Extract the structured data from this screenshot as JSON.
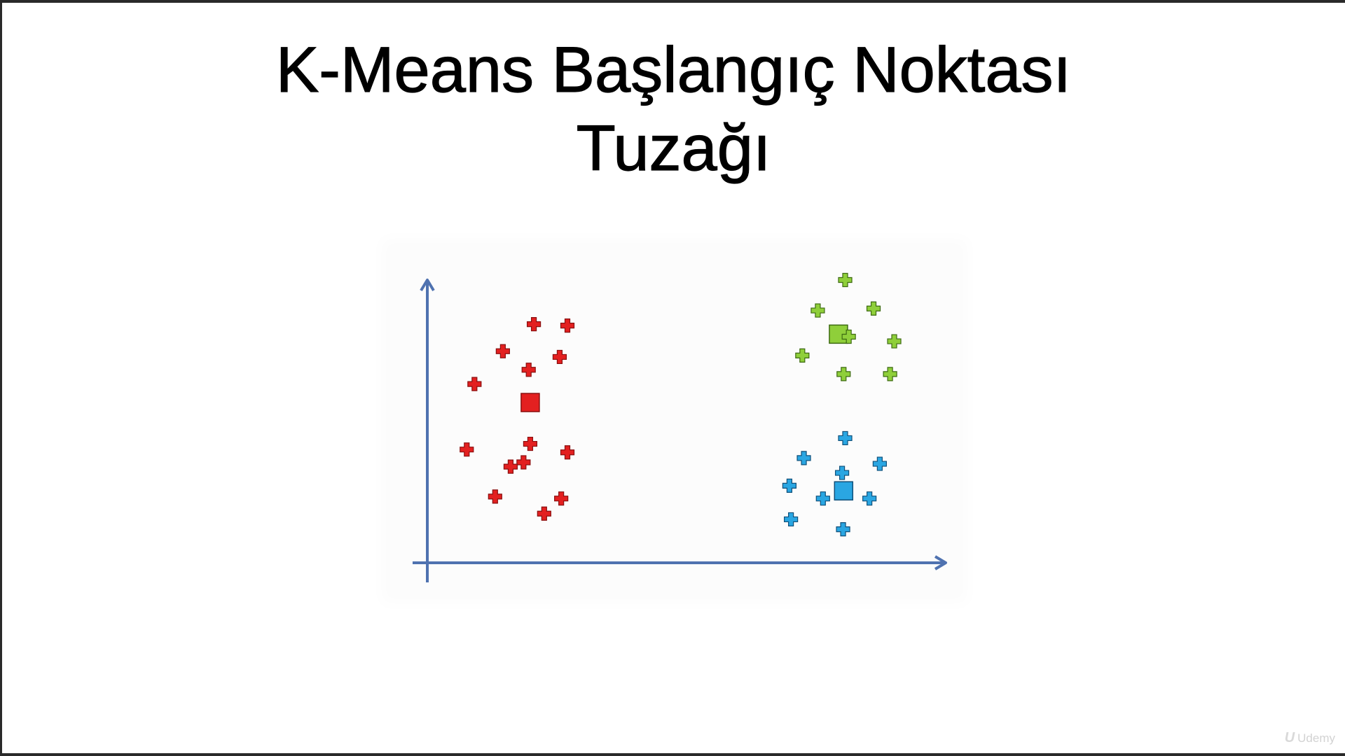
{
  "slide": {
    "title_line1": "K-Means Başlangıç Noktası",
    "title_line2": "Tuzağı"
  },
  "watermark": {
    "icon": "udemy-logo-icon",
    "text": "Udemy"
  },
  "chart_data": {
    "type": "scatter",
    "title": "",
    "xlabel": "",
    "ylabel": "",
    "axis_ticks": false,
    "grid": false,
    "xlim": [
      0,
      100
    ],
    "ylim": [
      0,
      100
    ],
    "series": [
      {
        "color": "#e32020",
        "stroke": "#8a1010",
        "points": [
          [
            20.5,
            84
          ],
          [
            27,
            83.5
          ],
          [
            14.5,
            74.5
          ],
          [
            25.5,
            72.5
          ],
          [
            19.5,
            68
          ],
          [
            9,
            63
          ],
          [
            18.5,
            35.5
          ],
          [
            27,
            39
          ],
          [
            7.5,
            40
          ],
          [
            16,
            34
          ],
          [
            25.8,
            22.8
          ],
          [
            13,
            23.5
          ],
          [
            22.5,
            17.5
          ],
          [
            19.8,
            42
          ]
        ],
        "centroid": [
          19.8,
          56.5
        ]
      },
      {
        "color": "#8fcf3a",
        "stroke": "#3d6a12",
        "points": [
          [
            80.8,
            99.5
          ],
          [
            75.5,
            88.8
          ],
          [
            86.3,
            89.5
          ],
          [
            81.5,
            79.6
          ],
          [
            90.3,
            78
          ],
          [
            72.5,
            73
          ],
          [
            80.5,
            66.5
          ],
          [
            89.5,
            66.5
          ]
        ],
        "centroid": [
          79.5,
          80.5
        ]
      },
      {
        "color": "#2aa6e2",
        "stroke": "#10507a",
        "points": [
          [
            80.8,
            44
          ],
          [
            72.8,
            37
          ],
          [
            87.5,
            35
          ],
          [
            80.2,
            31.8
          ],
          [
            70,
            27.3
          ],
          [
            76.5,
            22.8
          ],
          [
            85.5,
            22.8
          ],
          [
            70.3,
            15.5
          ],
          [
            80.4,
            12
          ]
        ],
        "centroid": [
          80.5,
          25.5
        ]
      }
    ]
  }
}
